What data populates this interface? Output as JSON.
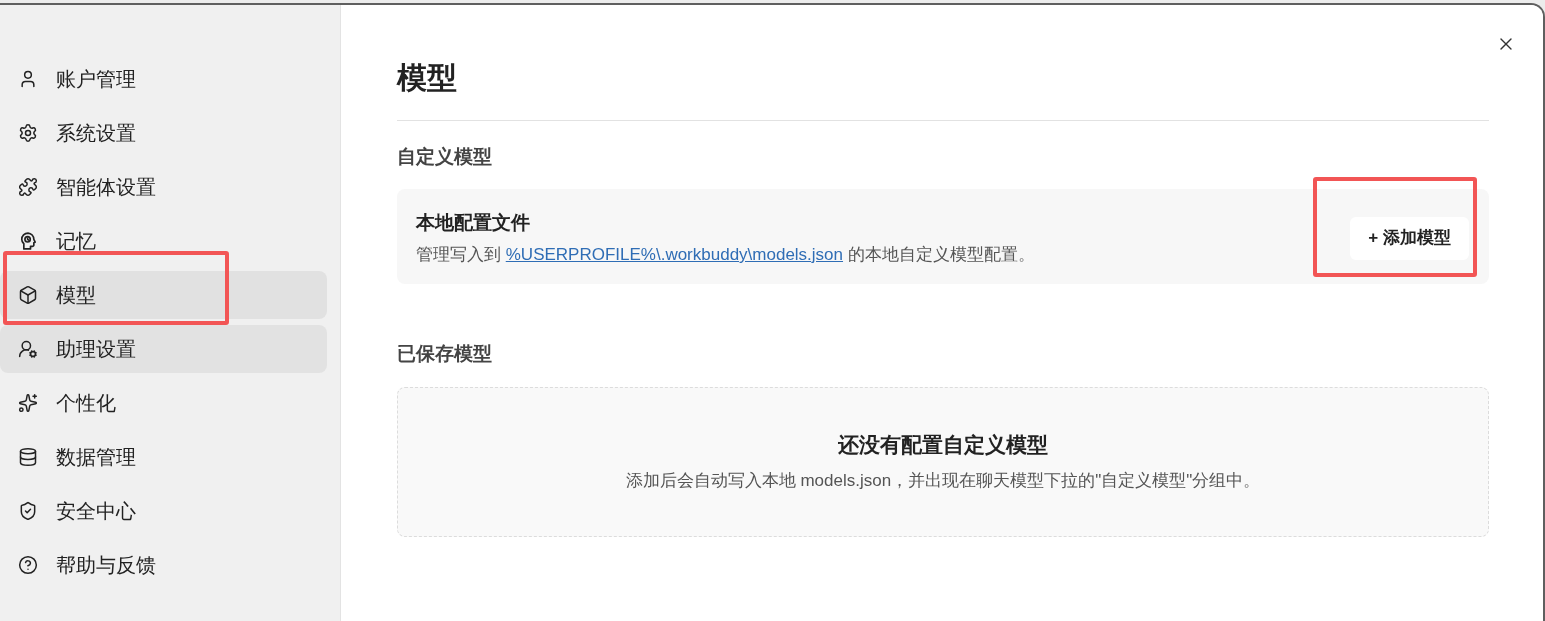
{
  "sidebar": {
    "items": [
      {
        "label": "账户管理",
        "selected": false,
        "hovered": false,
        "highlighted": false
      },
      {
        "label": "系统设置",
        "selected": false,
        "hovered": false,
        "highlighted": false
      },
      {
        "label": "智能体设置",
        "selected": false,
        "hovered": false,
        "highlighted": false
      },
      {
        "label": "记忆",
        "selected": false,
        "hovered": false,
        "highlighted": false
      },
      {
        "label": "模型",
        "selected": true,
        "hovered": false,
        "highlighted": true
      },
      {
        "label": "助理设置",
        "selected": false,
        "hovered": true,
        "highlighted": false
      },
      {
        "label": "个性化",
        "selected": false,
        "hovered": false,
        "highlighted": false
      },
      {
        "label": "数据管理",
        "selected": false,
        "hovered": false,
        "highlighted": false
      },
      {
        "label": "安全中心",
        "selected": false,
        "hovered": false,
        "highlighted": false
      },
      {
        "label": "帮助与反馈",
        "selected": false,
        "hovered": false,
        "highlighted": false
      }
    ]
  },
  "page": {
    "title": "模型"
  },
  "custom_section": {
    "heading": "自定义模型",
    "card": {
      "title": "本地配置文件",
      "description_before": "管理写入到",
      "link": "%USERPROFILE%\\.workbuddy\\models.json",
      "description_after": "的本地自定义模型配置。",
      "button": {
        "label": "+ 添加模型",
        "highlighted": true
      }
    }
  },
  "saved_section": {
    "heading": "已保存模型",
    "empty_state": {
      "title": "还没有配置自定义模型",
      "description": "添加后会自动写入本地 models.json，并出现在聊天模型下拉的\"自定义模型\"分组中。"
    }
  }
}
